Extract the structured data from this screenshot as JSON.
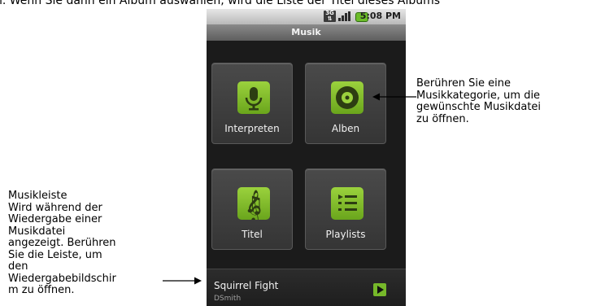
{
  "top_text": "n. Wenn Sie dann ein Album auswählen, wird die Liste der Titel dieses Albums",
  "status": {
    "time": "5:08 PM",
    "network": "3G"
  },
  "app_title": "Musik",
  "tiles": [
    {
      "label": "Interpreten",
      "icon": "microphone-icon"
    },
    {
      "label": "Alben",
      "icon": "disc-icon"
    },
    {
      "label": "Titel",
      "icon": "treble-clef-icon"
    },
    {
      "label": "Playlists",
      "icon": "playlist-icon"
    }
  ],
  "music_bar": {
    "song": "Squirrel Fight",
    "artist": "DSmith",
    "button_icon": "play-icon"
  },
  "callouts": {
    "right": [
      "Berühren Sie eine",
      "Musikkategorie, um die",
      "gewünschte Musikdatei",
      "zu öffnen."
    ],
    "left": [
      "Musikleiste",
      "Wird während der",
      "Wiedergabe einer",
      "Musikdatei",
      "angezeigt. Berühren",
      "Sie die Leiste, um",
      "den",
      "Wiedergabebildschir",
      "m zu öffnen."
    ]
  },
  "colors": {
    "accent_green": "#7ab82a",
    "screen_bg": "#1b1b1b"
  }
}
